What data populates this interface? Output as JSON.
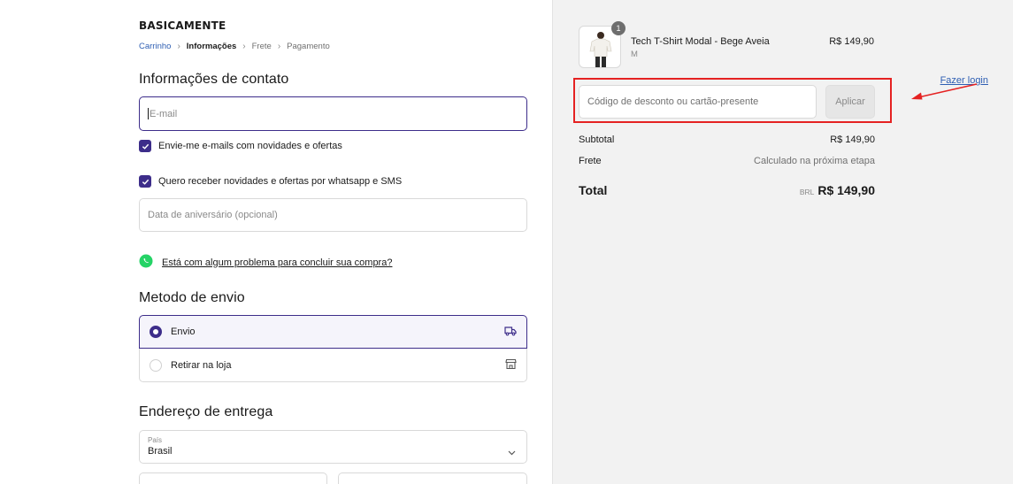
{
  "brand": {
    "logo": "BASICAMENTE"
  },
  "breadcrumb": {
    "items": [
      "Carrinho",
      "Informações",
      "Frete",
      "Pagamento"
    ]
  },
  "contact": {
    "title": "Informações de contato",
    "login_link": "Fazer login",
    "email_placeholder": "E-mail",
    "opt_email": "Envie-me e-mails com novidades e ofertas",
    "opt_whatsapp": "Quero receber novidades e ofertas por whatsapp e SMS",
    "birthday_placeholder": "Data de aniversário (opcional)",
    "help_link": "Está com algum problema para concluir sua compra?"
  },
  "shipping": {
    "title": "Metodo de envio",
    "options": [
      {
        "label": "Envio",
        "selected": true
      },
      {
        "label": "Retirar na loja",
        "selected": false
      }
    ]
  },
  "address": {
    "title": "Endereço de entrega",
    "country_label": "País",
    "country_value": "Brasil"
  },
  "summary": {
    "product": {
      "name": "Tech T-Shirt Modal - Bege Aveia",
      "variant": "M",
      "price": "R$ 149,90",
      "quantity": "1"
    },
    "discount_placeholder": "Código de desconto ou cartão-presente",
    "apply_label": "Aplicar",
    "subtotal_label": "Subtotal",
    "subtotal_value": "R$ 149,90",
    "frete_label": "Frete",
    "frete_value": "Calculado na próxima etapa",
    "total_label": "Total",
    "total_currency": "BRL",
    "total_value": "R$ 149,90"
  },
  "colors": {
    "accent": "#3d2d8a",
    "highlight": "#e52222",
    "whatsapp": "#25d366"
  }
}
